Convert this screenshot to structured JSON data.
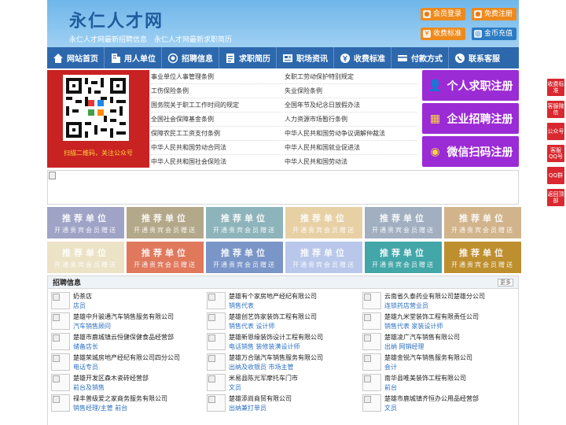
{
  "header": {
    "site_title": "永仁人才网",
    "tagline": "永仁人才网最新招聘信息　永仁人才网最新求职简历",
    "buttons": [
      {
        "label": "会员登录",
        "icon": "user-icon"
      },
      {
        "label": "免费注册",
        "icon": "register-icon"
      },
      {
        "label": "收费标准",
        "icon": "price-icon"
      },
      {
        "label": "金币充值",
        "icon": "coin-icon"
      }
    ]
  },
  "nav": [
    {
      "label": "网站首页",
      "icon": "home-icon"
    },
    {
      "label": "用人单位",
      "icon": "building-icon"
    },
    {
      "label": "招聘信息",
      "icon": "broadcast-icon"
    },
    {
      "label": "求职简历",
      "icon": "resume-icon"
    },
    {
      "label": "职场资讯",
      "icon": "news-icon"
    },
    {
      "label": "收费标准",
      "icon": "fee-icon"
    },
    {
      "label": "付款方式",
      "icon": "payment-icon"
    },
    {
      "label": "联系客服",
      "icon": "phone-icon"
    }
  ],
  "qr": {
    "caption": "扫描二维码，关注公众号"
  },
  "links": [
    "事业单位人事管理条例",
    "女职工劳动保护特别规定",
    "工伤保险条例",
    "失业保险条例",
    "国务院关于职工工作时间的规定",
    "全国年节及纪念日放假办法",
    "全国社会保障基金条例",
    "人力资源市场暂行条例",
    "保障农民工工资支付条例",
    "中华人民共和国劳动争议调解仲裁法",
    "中华人民共和国劳动合同法",
    "中华人民共和国就业促进法",
    "中华人民共和国社会保险法",
    "中华人民共和国劳动法"
  ],
  "register": [
    {
      "label": "个人求职注册",
      "icon": "person-icon"
    },
    {
      "label": "企业招聘注册",
      "icon": "company-icon"
    },
    {
      "label": "微信扫码注册",
      "icon": "wechat-icon"
    }
  ],
  "tiles": {
    "title": "推荐单位",
    "subtitle": "开通贵宾会员赠送",
    "colors": [
      "#9fa3c6",
      "#b4a88b",
      "#8eb4bb",
      "#e8d0a5",
      "#a1afc1",
      "#d2b48c",
      "#ece2c6",
      "#e0785c",
      "#7a95c8",
      "#b9c7ea",
      "#43a6a8",
      "#be8f2f"
    ]
  },
  "jobs": {
    "title": "招聘信息",
    "more": "更多",
    "items": [
      {
        "company": "奶茶店",
        "positions": "店员"
      },
      {
        "company": "楚雄有个家房地产经纪有限公司",
        "positions": "销售代表"
      },
      {
        "company": "云南省久泰药业有限公司楚雄分公司",
        "positions": "连锁药店营业员"
      },
      {
        "company": "楚雄中升骏通汽车销售服务有限公司",
        "positions": "汽车销售顾问"
      },
      {
        "company": "楚雄创艺饰家装饰工程有限公司",
        "positions": "销售代表 设计师"
      },
      {
        "company": "楚雄九米堂装饰工程有限责任公司",
        "positions": "销售代表 家装设计师"
      },
      {
        "company": "楚雄市鹿城镇云恒健保健食品经营部",
        "positions": "储备店长"
      },
      {
        "company": "楚雄新恩缘装饰设计工程有限公司",
        "positions": "电话销售 装修装潢设计师"
      },
      {
        "company": "楚雄凌广汽车销售有限公司",
        "positions": "出纳 网销经理"
      },
      {
        "company": "楚雄荣城房地产经纪有限公司四分公司",
        "positions": "电话专员"
      },
      {
        "company": "楚雄万合瑞汽车销售服务有限公司",
        "positions": "出纳及收银员 市场主管"
      },
      {
        "company": "楚雄金锐汽车销售服务有限公司",
        "positions": "会计"
      },
      {
        "company": "楚雄开发区森木瓷砖经营部",
        "positions": "前台及销售"
      },
      {
        "company": "米易县陈光军摩托车门市",
        "positions": "文员"
      },
      {
        "company": "南华县唯美装饰工程有限公司",
        "positions": "前台"
      },
      {
        "company": "禄丰普级爱之家商务服务有限公司",
        "positions": "销售经理/主管 前台"
      },
      {
        "company": "楚雄添尚商贸有限公司",
        "positions": "出纳兼打单员"
      },
      {
        "company": "楚雄市鹿城镇齐恒办公用品经营部",
        "positions": "文员"
      }
    ]
  },
  "float_bar": [
    {
      "label": "收费标准"
    },
    {
      "label": "客服微信"
    },
    {
      "label": "公众号"
    },
    {
      "label": "客服QQ号"
    },
    {
      "label": "QQ群"
    },
    {
      "label": "返回顶部"
    }
  ]
}
